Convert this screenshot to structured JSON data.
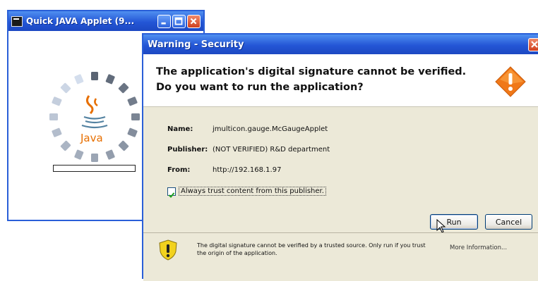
{
  "applet_window": {
    "title": "Quick JAVA Applet (9..."
  },
  "dialog": {
    "title": "Warning - Security",
    "heading_line1": "The application's digital signature cannot be verified.",
    "heading_line2": "Do you want to run the application?",
    "fields": {
      "name_label": "Name:",
      "name_value": "jmulticon.gauge.McGaugeApplet",
      "publisher_label": "Publisher:",
      "publisher_value": "(NOT VERIFIED) R&D department",
      "from_label": "From:",
      "from_value": "http://192.168.1.97"
    },
    "always_trust_label": "Always trust content from this publisher.",
    "always_trust_checked": true,
    "run_label": "Run",
    "cancel_label": "Cancel",
    "footer_text": "The digital signature cannot be verified by a trusted source.  Only run if you trust the origin of the application.",
    "more_info_label": "More Information..."
  },
  "colors": {
    "titlebar": "#2456d6",
    "dialog_bg": "#ece9d8",
    "warning_orange": "#f07818",
    "shield_yellow": "#f2d21e"
  }
}
